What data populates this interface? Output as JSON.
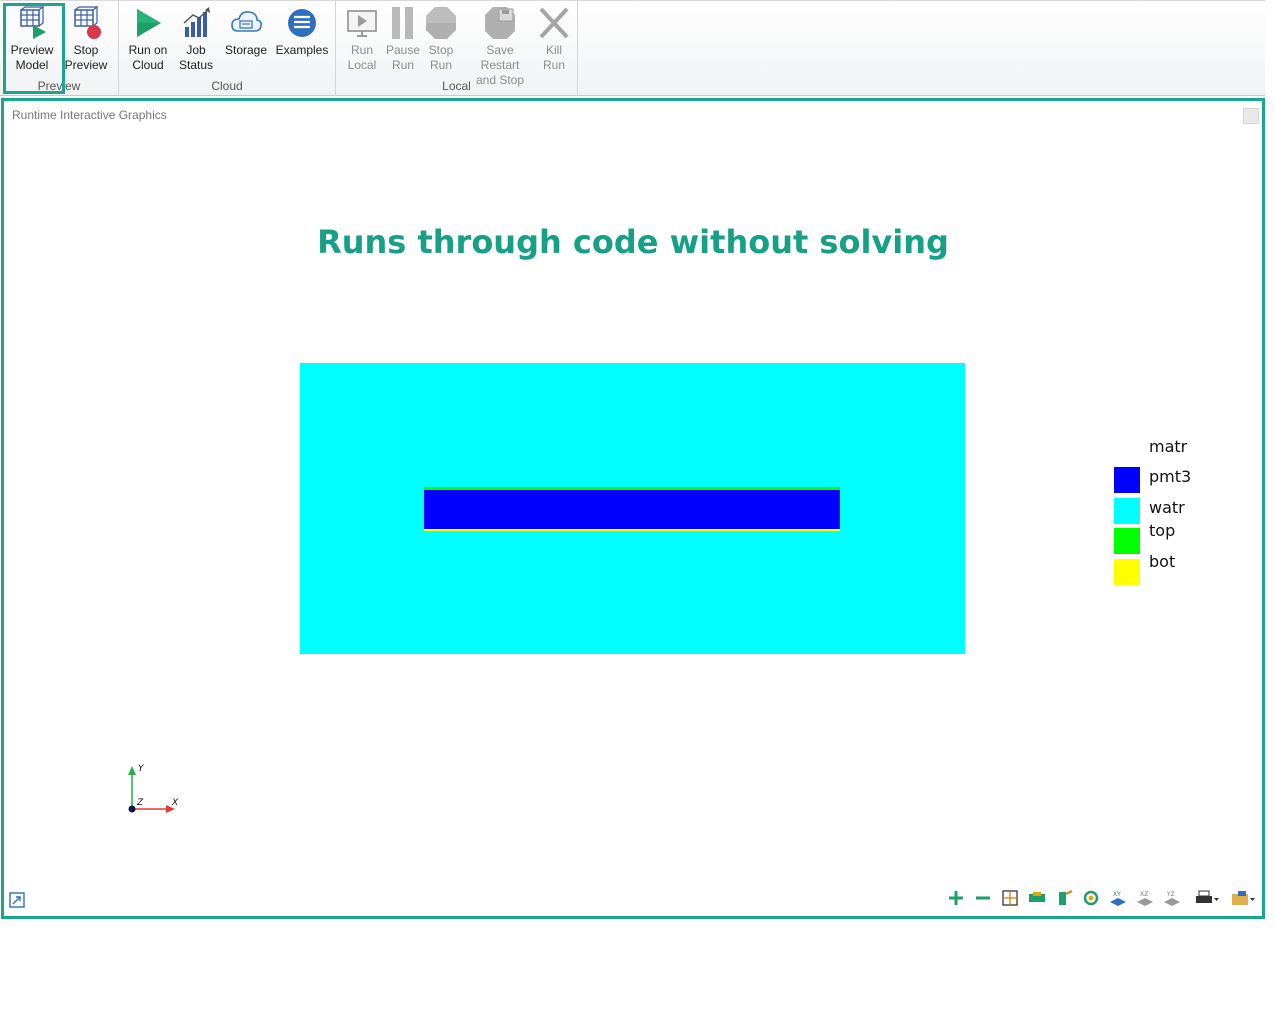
{
  "ribbon": {
    "groups": [
      {
        "label": "Preview",
        "buttons": [
          {
            "label": "Preview\nModel",
            "icon": "preview-model-icon"
          },
          {
            "label": "Stop\nPreview",
            "icon": "stop-preview-icon"
          }
        ]
      },
      {
        "label": "Cloud",
        "buttons": [
          {
            "label": "Run on\nCloud",
            "icon": "run-cloud-icon"
          },
          {
            "label": "Job\nStatus",
            "icon": "job-status-icon"
          },
          {
            "label": "Storage",
            "icon": "storage-icon"
          },
          {
            "label": "Examples",
            "icon": "examples-icon"
          }
        ]
      },
      {
        "label": "Local",
        "buttons": [
          {
            "label": "Run\nLocal",
            "icon": "run-local-icon"
          },
          {
            "label": "Pause\nRun",
            "icon": "pause-run-icon"
          },
          {
            "label": "Stop\nRun",
            "icon": "stop-run-icon"
          },
          {
            "label": "Save Restart\nand Stop",
            "icon": "save-restart-icon"
          },
          {
            "label": "Kill\nRun",
            "icon": "kill-run-icon"
          }
        ]
      }
    ]
  },
  "panel": {
    "title": "Runtime Interactive Graphics",
    "headline": "Runs through code without solving"
  },
  "legend": {
    "title": "matr",
    "items": [
      {
        "label": "pmt3",
        "color": "#0000ff"
      },
      {
        "label": "watr",
        "color": "#00ffff"
      },
      {
        "label": "top",
        "color": "#00ff00"
      },
      {
        "label": "bot",
        "color": "#ffff00"
      }
    ]
  },
  "axes": {
    "y": "Y",
    "x": "X",
    "z": "Z"
  },
  "colors": {
    "accent": "#1aa68a",
    "headline": "#16a085"
  }
}
